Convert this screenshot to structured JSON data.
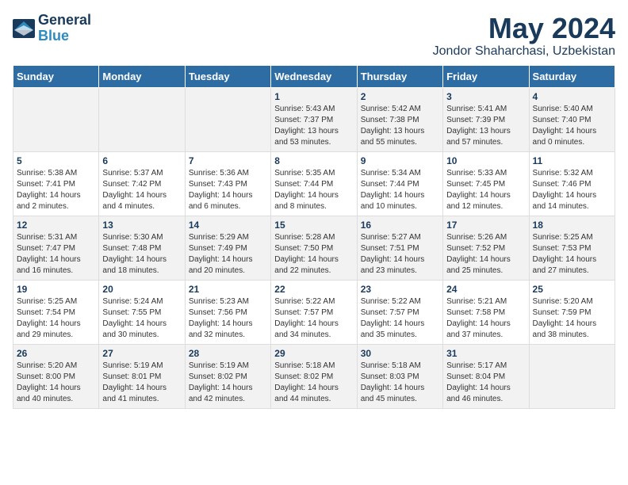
{
  "header": {
    "logo_line1": "General",
    "logo_line2": "Blue",
    "month": "May 2024",
    "location": "Jondor Shaharchasi, Uzbekistan"
  },
  "weekdays": [
    "Sunday",
    "Monday",
    "Tuesday",
    "Wednesday",
    "Thursday",
    "Friday",
    "Saturday"
  ],
  "weeks": [
    [
      {
        "day": "",
        "sunrise": "",
        "sunset": "",
        "daylight": ""
      },
      {
        "day": "",
        "sunrise": "",
        "sunset": "",
        "daylight": ""
      },
      {
        "day": "",
        "sunrise": "",
        "sunset": "",
        "daylight": ""
      },
      {
        "day": "1",
        "sunrise": "Sunrise: 5:43 AM",
        "sunset": "Sunset: 7:37 PM",
        "daylight": "Daylight: 13 hours and 53 minutes."
      },
      {
        "day": "2",
        "sunrise": "Sunrise: 5:42 AM",
        "sunset": "Sunset: 7:38 PM",
        "daylight": "Daylight: 13 hours and 55 minutes."
      },
      {
        "day": "3",
        "sunrise": "Sunrise: 5:41 AM",
        "sunset": "Sunset: 7:39 PM",
        "daylight": "Daylight: 13 hours and 57 minutes."
      },
      {
        "day": "4",
        "sunrise": "Sunrise: 5:40 AM",
        "sunset": "Sunset: 7:40 PM",
        "daylight": "Daylight: 14 hours and 0 minutes."
      }
    ],
    [
      {
        "day": "5",
        "sunrise": "Sunrise: 5:38 AM",
        "sunset": "Sunset: 7:41 PM",
        "daylight": "Daylight: 14 hours and 2 minutes."
      },
      {
        "day": "6",
        "sunrise": "Sunrise: 5:37 AM",
        "sunset": "Sunset: 7:42 PM",
        "daylight": "Daylight: 14 hours and 4 minutes."
      },
      {
        "day": "7",
        "sunrise": "Sunrise: 5:36 AM",
        "sunset": "Sunset: 7:43 PM",
        "daylight": "Daylight: 14 hours and 6 minutes."
      },
      {
        "day": "8",
        "sunrise": "Sunrise: 5:35 AM",
        "sunset": "Sunset: 7:44 PM",
        "daylight": "Daylight: 14 hours and 8 minutes."
      },
      {
        "day": "9",
        "sunrise": "Sunrise: 5:34 AM",
        "sunset": "Sunset: 7:44 PM",
        "daylight": "Daylight: 14 hours and 10 minutes."
      },
      {
        "day": "10",
        "sunrise": "Sunrise: 5:33 AM",
        "sunset": "Sunset: 7:45 PM",
        "daylight": "Daylight: 14 hours and 12 minutes."
      },
      {
        "day": "11",
        "sunrise": "Sunrise: 5:32 AM",
        "sunset": "Sunset: 7:46 PM",
        "daylight": "Daylight: 14 hours and 14 minutes."
      }
    ],
    [
      {
        "day": "12",
        "sunrise": "Sunrise: 5:31 AM",
        "sunset": "Sunset: 7:47 PM",
        "daylight": "Daylight: 14 hours and 16 minutes."
      },
      {
        "day": "13",
        "sunrise": "Sunrise: 5:30 AM",
        "sunset": "Sunset: 7:48 PM",
        "daylight": "Daylight: 14 hours and 18 minutes."
      },
      {
        "day": "14",
        "sunrise": "Sunrise: 5:29 AM",
        "sunset": "Sunset: 7:49 PM",
        "daylight": "Daylight: 14 hours and 20 minutes."
      },
      {
        "day": "15",
        "sunrise": "Sunrise: 5:28 AM",
        "sunset": "Sunset: 7:50 PM",
        "daylight": "Daylight: 14 hours and 22 minutes."
      },
      {
        "day": "16",
        "sunrise": "Sunrise: 5:27 AM",
        "sunset": "Sunset: 7:51 PM",
        "daylight": "Daylight: 14 hours and 23 minutes."
      },
      {
        "day": "17",
        "sunrise": "Sunrise: 5:26 AM",
        "sunset": "Sunset: 7:52 PM",
        "daylight": "Daylight: 14 hours and 25 minutes."
      },
      {
        "day": "18",
        "sunrise": "Sunrise: 5:25 AM",
        "sunset": "Sunset: 7:53 PM",
        "daylight": "Daylight: 14 hours and 27 minutes."
      }
    ],
    [
      {
        "day": "19",
        "sunrise": "Sunrise: 5:25 AM",
        "sunset": "Sunset: 7:54 PM",
        "daylight": "Daylight: 14 hours and 29 minutes."
      },
      {
        "day": "20",
        "sunrise": "Sunrise: 5:24 AM",
        "sunset": "Sunset: 7:55 PM",
        "daylight": "Daylight: 14 hours and 30 minutes."
      },
      {
        "day": "21",
        "sunrise": "Sunrise: 5:23 AM",
        "sunset": "Sunset: 7:56 PM",
        "daylight": "Daylight: 14 hours and 32 minutes."
      },
      {
        "day": "22",
        "sunrise": "Sunrise: 5:22 AM",
        "sunset": "Sunset: 7:57 PM",
        "daylight": "Daylight: 14 hours and 34 minutes."
      },
      {
        "day": "23",
        "sunrise": "Sunrise: 5:22 AM",
        "sunset": "Sunset: 7:57 PM",
        "daylight": "Daylight: 14 hours and 35 minutes."
      },
      {
        "day": "24",
        "sunrise": "Sunrise: 5:21 AM",
        "sunset": "Sunset: 7:58 PM",
        "daylight": "Daylight: 14 hours and 37 minutes."
      },
      {
        "day": "25",
        "sunrise": "Sunrise: 5:20 AM",
        "sunset": "Sunset: 7:59 PM",
        "daylight": "Daylight: 14 hours and 38 minutes."
      }
    ],
    [
      {
        "day": "26",
        "sunrise": "Sunrise: 5:20 AM",
        "sunset": "Sunset: 8:00 PM",
        "daylight": "Daylight: 14 hours and 40 minutes."
      },
      {
        "day": "27",
        "sunrise": "Sunrise: 5:19 AM",
        "sunset": "Sunset: 8:01 PM",
        "daylight": "Daylight: 14 hours and 41 minutes."
      },
      {
        "day": "28",
        "sunrise": "Sunrise: 5:19 AM",
        "sunset": "Sunset: 8:02 PM",
        "daylight": "Daylight: 14 hours and 42 minutes."
      },
      {
        "day": "29",
        "sunrise": "Sunrise: 5:18 AM",
        "sunset": "Sunset: 8:02 PM",
        "daylight": "Daylight: 14 hours and 44 minutes."
      },
      {
        "day": "30",
        "sunrise": "Sunrise: 5:18 AM",
        "sunset": "Sunset: 8:03 PM",
        "daylight": "Daylight: 14 hours and 45 minutes."
      },
      {
        "day": "31",
        "sunrise": "Sunrise: 5:17 AM",
        "sunset": "Sunset: 8:04 PM",
        "daylight": "Daylight: 14 hours and 46 minutes."
      },
      {
        "day": "",
        "sunrise": "",
        "sunset": "",
        "daylight": ""
      }
    ]
  ]
}
